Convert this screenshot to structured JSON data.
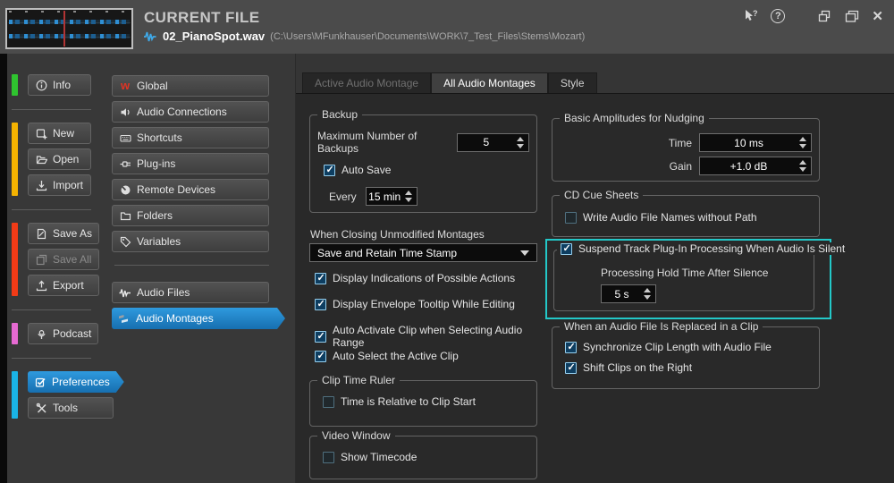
{
  "header": {
    "title": "CURRENT FILE",
    "file_name": "02_PianoSpot.wav",
    "file_path": "(C:\\Users\\MFunkhauser\\Documents\\WORK\\7_Test_Files\\Stems\\Mozart)"
  },
  "window_controls": {
    "close_glyph": "✕",
    "help_glyph": "?"
  },
  "sidebar": {
    "bar_colors": {
      "info": "#2fc42f",
      "file": "#f5b301",
      "save": "#f23b17",
      "podcast": "#e66ad2",
      "settings": "#1ab4e6"
    },
    "info": "Info",
    "new": "New",
    "open": "Open",
    "import": "Import",
    "save_as": "Save As",
    "save_all": "Save All",
    "export": "Export",
    "podcast": "Podcast",
    "preferences": "Preferences",
    "tools": "Tools"
  },
  "categories": {
    "global": "Global",
    "audio_connections": "Audio Connections",
    "shortcuts": "Shortcuts",
    "plug_ins": "Plug-ins",
    "remote_devices": "Remote Devices",
    "folders": "Folders",
    "variables": "Variables",
    "audio_files": "Audio Files",
    "audio_montages": "Audio Montages"
  },
  "tabs": {
    "active_audio_montage": "Active Audio Montage",
    "all_audio_montages": "All Audio Montages",
    "style": "Style"
  },
  "panel": {
    "backup": {
      "title": "Backup",
      "max_label": "Maximum Number of Backups",
      "max_value": "5",
      "auto_save": {
        "label": "Auto Save",
        "checked": true
      },
      "every_label": "Every",
      "every_value": "15 min"
    },
    "closing": {
      "label": "When Closing Unmodified Montages",
      "value": "Save and Retain Time Stamp"
    },
    "options": [
      {
        "label": "Display Indications of Possible Actions",
        "checked": true
      },
      {
        "label": "Display Envelope Tooltip While Editing",
        "checked": true
      },
      {
        "label": "Auto Activate Clip when Selecting Audio Range",
        "checked": true
      },
      {
        "label": "Auto Select the Active Clip",
        "checked": true
      }
    ],
    "clip_time_ruler": {
      "title": "Clip Time Ruler",
      "option": {
        "label": "Time is Relative to Clip Start",
        "checked": false
      }
    },
    "video_window": {
      "title": "Video Window",
      "option": {
        "label": "Show Timecode",
        "checked": false
      }
    },
    "nudging": {
      "title": "Basic Amplitudes for Nudging",
      "time_label": "Time",
      "time_value": "10 ms",
      "gain_label": "Gain",
      "gain_value": "+1.0 dB"
    },
    "cd_cue_sheets": {
      "title": "CD Cue Sheets",
      "option": {
        "label": "Write Audio File Names without Path",
        "checked": false
      }
    },
    "suspend": {
      "option": {
        "label": "Suspend Track Plug-In Processing When Audio Is Silent",
        "checked": true
      },
      "hold_label": "Processing Hold Time After Silence",
      "hold_value": "5 s",
      "highlight_color": "#23c8c8"
    },
    "replaced": {
      "title": "When an Audio File Is Replaced in a Clip",
      "options": [
        {
          "label": "Synchronize Clip Length with Audio File",
          "checked": true
        },
        {
          "label": "Shift Clips on the Right",
          "checked": true
        }
      ]
    }
  }
}
